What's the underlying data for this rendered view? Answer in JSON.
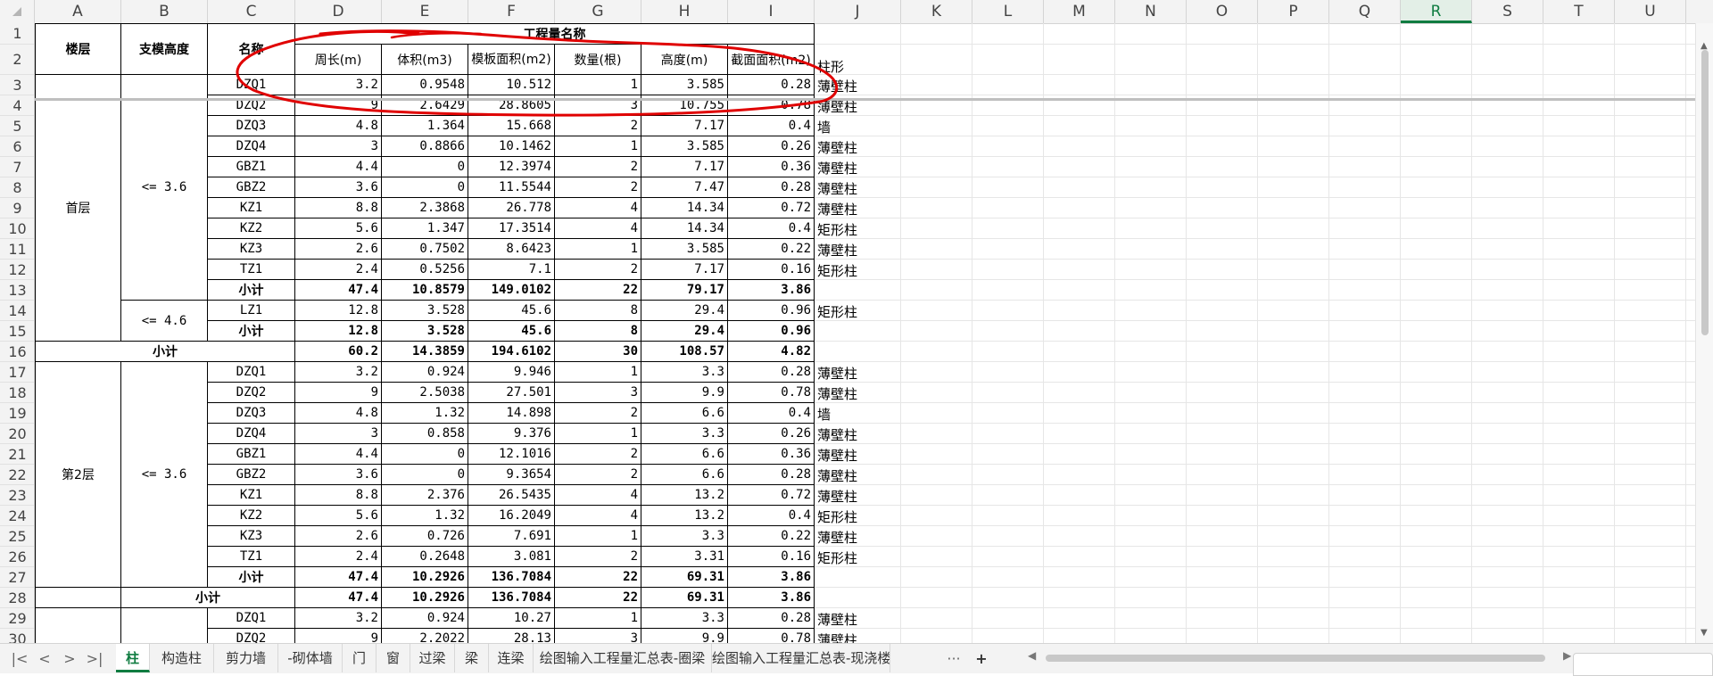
{
  "columns": [
    "A",
    "B",
    "C",
    "D",
    "E",
    "F",
    "G",
    "H",
    "I",
    "J",
    "K",
    "L",
    "M",
    "N",
    "O",
    "P",
    "Q",
    "R",
    "S",
    "T",
    "U"
  ],
  "selected_column": "R",
  "header": {
    "floor": "楼层",
    "support_height": "支模高度",
    "name": "名称",
    "quantity_group": "工程量名称",
    "perimeter": "周长(m)",
    "volume": "体积(m3)",
    "formwork_area": "模板面积(m2)",
    "count": "数量(根)",
    "height": "高度(m)",
    "section_area": "截面面积(m2)",
    "j2": "柱形"
  },
  "groups": {
    "floor1": "首层",
    "floor2": "第2层",
    "h36": "<= 3.6",
    "h46": "<= 4.6",
    "subtotal": "小计"
  },
  "rows": [
    {
      "row": "3",
      "name": "DZQ1",
      "d": "3.2",
      "e": "0.9548",
      "f": "10.512",
      "g": "1",
      "h": "3.585",
      "i": "0.28",
      "j": "薄壁柱"
    },
    {
      "row": "4",
      "name": "DZQ2",
      "d": "9",
      "e": "2.6429",
      "f": "28.8605",
      "g": "3",
      "h": "10.755",
      "i": "0.78",
      "j": "薄壁柱"
    },
    {
      "row": "5",
      "name": "DZQ3",
      "d": "4.8",
      "e": "1.364",
      "f": "15.668",
      "g": "2",
      "h": "7.17",
      "i": "0.4",
      "j": "墙"
    },
    {
      "row": "6",
      "name": "DZQ4",
      "d": "3",
      "e": "0.8866",
      "f": "10.1462",
      "g": "1",
      "h": "3.585",
      "i": "0.26",
      "j": "薄壁柱"
    },
    {
      "row": "7",
      "name": "GBZ1",
      "d": "4.4",
      "e": "0",
      "f": "12.3974",
      "g": "2",
      "h": "7.17",
      "i": "0.36",
      "j": "薄壁柱"
    },
    {
      "row": "8",
      "name": "GBZ2",
      "d": "3.6",
      "e": "0",
      "f": "11.5544",
      "g": "2",
      "h": "7.47",
      "i": "0.28",
      "j": "薄壁柱"
    },
    {
      "row": "9",
      "name": "KZ1",
      "d": "8.8",
      "e": "2.3868",
      "f": "26.778",
      "g": "4",
      "h": "14.34",
      "i": "0.72",
      "j": "薄壁柱"
    },
    {
      "row": "10",
      "name": "KZ2",
      "d": "5.6",
      "e": "1.347",
      "f": "17.3514",
      "g": "4",
      "h": "14.34",
      "i": "0.4",
      "j": "矩形柱"
    },
    {
      "row": "11",
      "name": "KZ3",
      "d": "2.6",
      "e": "0.7502",
      "f": "8.6423",
      "g": "1",
      "h": "3.585",
      "i": "0.22",
      "j": "薄壁柱"
    },
    {
      "row": "12",
      "name": "TZ1",
      "d": "2.4",
      "e": "0.5256",
      "f": "7.1",
      "g": "2",
      "h": "7.17",
      "i": "0.16",
      "j": "矩形柱"
    },
    {
      "row": "13",
      "name": "小计",
      "d": "47.4",
      "e": "10.8579",
      "f": "149.0102",
      "g": "22",
      "h": "79.17",
      "i": "3.86",
      "j": "",
      "bold": true
    },
    {
      "row": "14",
      "name": "LZ1",
      "d": "12.8",
      "e": "3.528",
      "f": "45.6",
      "g": "8",
      "h": "29.4",
      "i": "0.96",
      "j": "矩形柱"
    },
    {
      "row": "15",
      "name": "小计",
      "d": "12.8",
      "e": "3.528",
      "f": "45.6",
      "g": "8",
      "h": "29.4",
      "i": "0.96",
      "j": "",
      "bold": true
    },
    {
      "row": "16",
      "name": "小计",
      "d": "60.2",
      "e": "14.3859",
      "f": "194.6102",
      "g": "30",
      "h": "108.57",
      "i": "4.82",
      "j": "",
      "bold": true
    },
    {
      "row": "17",
      "name": "DZQ1",
      "d": "3.2",
      "e": "0.924",
      "f": "9.946",
      "g": "1",
      "h": "3.3",
      "i": "0.28",
      "j": "薄壁柱"
    },
    {
      "row": "18",
      "name": "DZQ2",
      "d": "9",
      "e": "2.5038",
      "f": "27.501",
      "g": "3",
      "h": "9.9",
      "i": "0.78",
      "j": "薄壁柱"
    },
    {
      "row": "19",
      "name": "DZQ3",
      "d": "4.8",
      "e": "1.32",
      "f": "14.898",
      "g": "2",
      "h": "6.6",
      "i": "0.4",
      "j": "墙"
    },
    {
      "row": "20",
      "name": "DZQ4",
      "d": "3",
      "e": "0.858",
      "f": "9.376",
      "g": "1",
      "h": "3.3",
      "i": "0.26",
      "j": "薄壁柱"
    },
    {
      "row": "21",
      "name": "GBZ1",
      "d": "4.4",
      "e": "0",
      "f": "12.1016",
      "g": "2",
      "h": "6.6",
      "i": "0.36",
      "j": "薄壁柱"
    },
    {
      "row": "22",
      "name": "GBZ2",
      "d": "3.6",
      "e": "0",
      "f": "9.3654",
      "g": "2",
      "h": "6.6",
      "i": "0.28",
      "j": "薄壁柱"
    },
    {
      "row": "23",
      "name": "KZ1",
      "d": "8.8",
      "e": "2.376",
      "f": "26.5435",
      "g": "4",
      "h": "13.2",
      "i": "0.72",
      "j": "薄壁柱"
    },
    {
      "row": "24",
      "name": "KZ2",
      "d": "5.6",
      "e": "1.32",
      "f": "16.2049",
      "g": "4",
      "h": "13.2",
      "i": "0.4",
      "j": "矩形柱"
    },
    {
      "row": "25",
      "name": "KZ3",
      "d": "2.6",
      "e": "0.726",
      "f": "7.691",
      "g": "1",
      "h": "3.3",
      "i": "0.22",
      "j": "薄壁柱"
    },
    {
      "row": "26",
      "name": "TZ1",
      "d": "2.4",
      "e": "0.2648",
      "f": "3.081",
      "g": "2",
      "h": "3.31",
      "i": "0.16",
      "j": "矩形柱"
    },
    {
      "row": "27",
      "name": "小计",
      "d": "47.4",
      "e": "10.2926",
      "f": "136.7084",
      "g": "22",
      "h": "69.31",
      "i": "3.86",
      "j": "",
      "bold": true
    },
    {
      "row": "28",
      "name": "小计",
      "d": "47.4",
      "e": "10.2926",
      "f": "136.7084",
      "g": "22",
      "h": "69.31",
      "i": "3.86",
      "j": "",
      "bold": true
    },
    {
      "row": "29",
      "name": "DZQ1",
      "d": "3.2",
      "e": "0.924",
      "f": "10.27",
      "g": "1",
      "h": "3.3",
      "i": "0.28",
      "j": "薄壁柱"
    },
    {
      "row": "30",
      "name": "DZQ2",
      "d": "9",
      "e": "2.2022",
      "f": "28.13",
      "g": "3",
      "h": "9.9",
      "i": "0.78",
      "j": "薄壁柱"
    }
  ],
  "sheet_tabs": [
    "柱",
    "构造柱",
    "剪力墙",
    "-砌体墙",
    "门",
    "窗",
    "过梁",
    "梁",
    "连梁",
    "绘图输入工程量汇总表-圈梁",
    "绘图输入工程量汇总表-现浇楼"
  ],
  "active_tab": "柱",
  "tab_nav": {
    "first": "|<",
    "prev": "<",
    "next": ">",
    "last": ">|",
    "more": "···",
    "add": "+"
  },
  "markup_color": "#e00000"
}
